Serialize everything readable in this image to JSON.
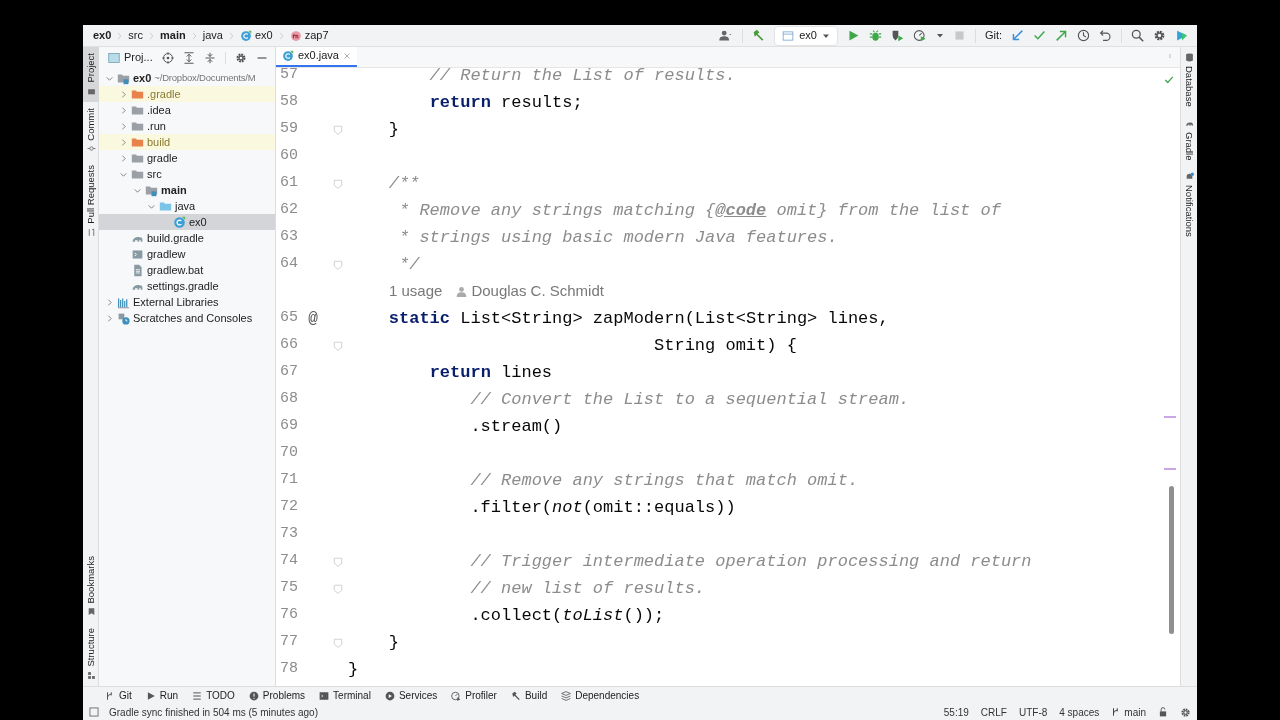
{
  "breadcrumbs": [
    {
      "label": "ex0",
      "kind": "module"
    },
    {
      "label": "src",
      "kind": "plain"
    },
    {
      "label": "main",
      "kind": "module"
    },
    {
      "label": "java",
      "kind": "plain"
    },
    {
      "label": "ex0",
      "kind": "class"
    },
    {
      "label": "zap7",
      "kind": "method"
    }
  ],
  "toolbar": {
    "run_config": "ex0",
    "git_label": "Git:",
    "stop_disabled": true
  },
  "left_strip": {
    "top": [
      {
        "label": "Project",
        "selected": true
      },
      {
        "label": "Commit",
        "selected": false
      },
      {
        "label": "Pull Requests",
        "selected": false
      }
    ],
    "bottom": [
      {
        "label": "Bookmarks",
        "selected": false
      },
      {
        "label": "Structure",
        "selected": false
      }
    ]
  },
  "project_panel": {
    "title": "Proj...",
    "tree": [
      {
        "label": "ex0",
        "path": "~/Dropbox/Documents/M",
        "kind": "module",
        "expanded": true,
        "selected": false,
        "excluded": false,
        "children": [
          {
            "label": ".gradle",
            "kind": "folder",
            "expanded": false,
            "selected": false,
            "excluded": true
          },
          {
            "label": ".idea",
            "kind": "folder",
            "expanded": false,
            "selected": false,
            "excluded": false
          },
          {
            "label": ".run",
            "kind": "folder",
            "expanded": false,
            "selected": false,
            "excluded": false
          },
          {
            "label": "build",
            "kind": "folder",
            "expanded": false,
            "selected": false,
            "excluded": true
          },
          {
            "label": "gradle",
            "kind": "folder",
            "expanded": false,
            "selected": false,
            "excluded": false
          },
          {
            "label": "src",
            "kind": "folder",
            "expanded": true,
            "selected": false,
            "excluded": false,
            "children": [
              {
                "label": "main",
                "kind": "module",
                "expanded": true,
                "selected": false,
                "excluded": false,
                "children": [
                  {
                    "label": "java",
                    "kind": "source",
                    "expanded": true,
                    "selected": false,
                    "excluded": false,
                    "children": [
                      {
                        "label": "ex0",
                        "kind": "class",
                        "selected": true,
                        "excluded": false
                      }
                    ]
                  }
                ]
              }
            ]
          },
          {
            "label": "build.gradle",
            "kind": "gradle",
            "selected": false,
            "excluded": false
          },
          {
            "label": "gradlew",
            "kind": "script",
            "selected": false,
            "excluded": false
          },
          {
            "label": "gradlew.bat",
            "kind": "file",
            "selected": false,
            "excluded": false
          },
          {
            "label": "settings.gradle",
            "kind": "gradle",
            "selected": false,
            "excluded": false
          }
        ]
      },
      {
        "label": "External Libraries",
        "kind": "libraries",
        "expanded": false,
        "selected": false,
        "excluded": false
      },
      {
        "label": "Scratches and Consoles",
        "kind": "scratches",
        "expanded": false,
        "selected": false,
        "excluded": false
      }
    ]
  },
  "editor": {
    "tabs": [
      {
        "label": "ex0.java",
        "selected": true
      }
    ],
    "lines": [
      {
        "number": "57",
        "kind": "comment",
        "fold": false,
        "text": "        // Return the List of results."
      },
      {
        "number": "58",
        "kind": "code",
        "fold": false,
        "text": "        **return** results;"
      },
      {
        "number": "59",
        "kind": "code",
        "fold": true,
        "text": "    }"
      },
      {
        "number": "60",
        "kind": "blank",
        "fold": false
      },
      {
        "number": "61",
        "kind": "comment",
        "fold": true,
        "text": "    /**"
      },
      {
        "number": "62",
        "kind": "doc",
        "fold": false,
        "text": "     * Remove any strings matching {**@code** omit} from the list of"
      },
      {
        "number": "63",
        "kind": "comment",
        "fold": false,
        "text": "     * strings using basic modern Java features."
      },
      {
        "number": "64",
        "kind": "comment",
        "fold": true,
        "text": "     */"
      },
      {
        "kind": "inlay",
        "usage": "1 usage",
        "author": "Douglas C. Schmidt"
      },
      {
        "number": "65",
        "kind": "code",
        "fold": false,
        "marker": "@",
        "text": "    **static** List<String> zapModern(List<String> lines,"
      },
      {
        "number": "66",
        "kind": "code",
        "fold": true,
        "text": "                              String omit) {"
      },
      {
        "number": "67",
        "kind": "code",
        "fold": false,
        "text": "        **return** lines"
      },
      {
        "number": "68",
        "kind": "comment",
        "fold": false,
        "text": "            // Convert the List to a sequential stream."
      },
      {
        "number": "69",
        "kind": "code",
        "fold": false,
        "text": "            .stream()"
      },
      {
        "number": "70",
        "kind": "blank",
        "fold": false
      },
      {
        "number": "71",
        "kind": "comment",
        "fold": false,
        "text": "            // Remove any strings that match omit."
      },
      {
        "number": "72",
        "kind": "code",
        "fold": false,
        "text": "            .filter(*not*(omit::equals))"
      },
      {
        "number": "73",
        "kind": "blank",
        "fold": false
      },
      {
        "number": "74",
        "kind": "comment",
        "fold": true,
        "text": "            // Trigger intermediate operation processing and return"
      },
      {
        "number": "75",
        "kind": "comment",
        "fold": true,
        "text": "            // new list of results."
      },
      {
        "number": "76",
        "kind": "code",
        "fold": false,
        "text": "            .collect(*toList*());"
      },
      {
        "number": "77",
        "kind": "code",
        "fold": true,
        "text": "    }"
      },
      {
        "number": "78",
        "kind": "code",
        "fold": false,
        "text": "}"
      }
    ]
  },
  "right_strip": [
    {
      "label": "Database"
    },
    {
      "label": "Gradle"
    },
    {
      "label": "Notifications"
    }
  ],
  "tool_windows": [
    {
      "label": "Git"
    },
    {
      "label": "Run"
    },
    {
      "label": "TODO"
    },
    {
      "label": "Problems"
    },
    {
      "label": "Terminal"
    },
    {
      "label": "Services"
    },
    {
      "label": "Profiler"
    },
    {
      "label": "Build"
    },
    {
      "label": "Dependencies"
    }
  ],
  "status_bar": {
    "message": "Gradle sync finished in 504 ms (5 minutes ago)",
    "position": "55:19",
    "line_ending": "CRLF",
    "encoding": "UTF-8",
    "indent": "4 spaces",
    "branch": "main"
  }
}
